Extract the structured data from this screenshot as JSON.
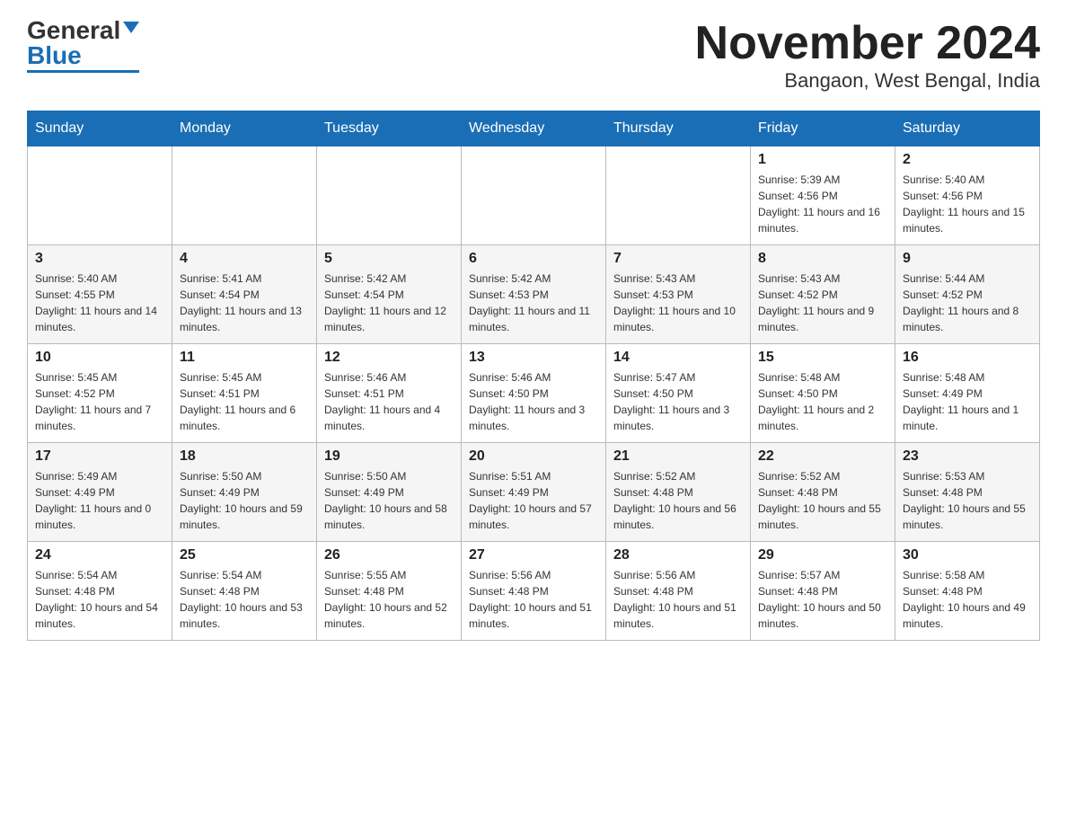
{
  "header": {
    "logo_general": "General",
    "logo_blue": "Blue",
    "month_title": "November 2024",
    "location": "Bangaon, West Bengal, India"
  },
  "days_of_week": [
    "Sunday",
    "Monday",
    "Tuesday",
    "Wednesday",
    "Thursday",
    "Friday",
    "Saturday"
  ],
  "weeks": [
    [
      {
        "day": "",
        "info": ""
      },
      {
        "day": "",
        "info": ""
      },
      {
        "day": "",
        "info": ""
      },
      {
        "day": "",
        "info": ""
      },
      {
        "day": "",
        "info": ""
      },
      {
        "day": "1",
        "info": "Sunrise: 5:39 AM\nSunset: 4:56 PM\nDaylight: 11 hours and 16 minutes."
      },
      {
        "day": "2",
        "info": "Sunrise: 5:40 AM\nSunset: 4:56 PM\nDaylight: 11 hours and 15 minutes."
      }
    ],
    [
      {
        "day": "3",
        "info": "Sunrise: 5:40 AM\nSunset: 4:55 PM\nDaylight: 11 hours and 14 minutes."
      },
      {
        "day": "4",
        "info": "Sunrise: 5:41 AM\nSunset: 4:54 PM\nDaylight: 11 hours and 13 minutes."
      },
      {
        "day": "5",
        "info": "Sunrise: 5:42 AM\nSunset: 4:54 PM\nDaylight: 11 hours and 12 minutes."
      },
      {
        "day": "6",
        "info": "Sunrise: 5:42 AM\nSunset: 4:53 PM\nDaylight: 11 hours and 11 minutes."
      },
      {
        "day": "7",
        "info": "Sunrise: 5:43 AM\nSunset: 4:53 PM\nDaylight: 11 hours and 10 minutes."
      },
      {
        "day": "8",
        "info": "Sunrise: 5:43 AM\nSunset: 4:52 PM\nDaylight: 11 hours and 9 minutes."
      },
      {
        "day": "9",
        "info": "Sunrise: 5:44 AM\nSunset: 4:52 PM\nDaylight: 11 hours and 8 minutes."
      }
    ],
    [
      {
        "day": "10",
        "info": "Sunrise: 5:45 AM\nSunset: 4:52 PM\nDaylight: 11 hours and 7 minutes."
      },
      {
        "day": "11",
        "info": "Sunrise: 5:45 AM\nSunset: 4:51 PM\nDaylight: 11 hours and 6 minutes."
      },
      {
        "day": "12",
        "info": "Sunrise: 5:46 AM\nSunset: 4:51 PM\nDaylight: 11 hours and 4 minutes."
      },
      {
        "day": "13",
        "info": "Sunrise: 5:46 AM\nSunset: 4:50 PM\nDaylight: 11 hours and 3 minutes."
      },
      {
        "day": "14",
        "info": "Sunrise: 5:47 AM\nSunset: 4:50 PM\nDaylight: 11 hours and 3 minutes."
      },
      {
        "day": "15",
        "info": "Sunrise: 5:48 AM\nSunset: 4:50 PM\nDaylight: 11 hours and 2 minutes."
      },
      {
        "day": "16",
        "info": "Sunrise: 5:48 AM\nSunset: 4:49 PM\nDaylight: 11 hours and 1 minute."
      }
    ],
    [
      {
        "day": "17",
        "info": "Sunrise: 5:49 AM\nSunset: 4:49 PM\nDaylight: 11 hours and 0 minutes."
      },
      {
        "day": "18",
        "info": "Sunrise: 5:50 AM\nSunset: 4:49 PM\nDaylight: 10 hours and 59 minutes."
      },
      {
        "day": "19",
        "info": "Sunrise: 5:50 AM\nSunset: 4:49 PM\nDaylight: 10 hours and 58 minutes."
      },
      {
        "day": "20",
        "info": "Sunrise: 5:51 AM\nSunset: 4:49 PM\nDaylight: 10 hours and 57 minutes."
      },
      {
        "day": "21",
        "info": "Sunrise: 5:52 AM\nSunset: 4:48 PM\nDaylight: 10 hours and 56 minutes."
      },
      {
        "day": "22",
        "info": "Sunrise: 5:52 AM\nSunset: 4:48 PM\nDaylight: 10 hours and 55 minutes."
      },
      {
        "day": "23",
        "info": "Sunrise: 5:53 AM\nSunset: 4:48 PM\nDaylight: 10 hours and 55 minutes."
      }
    ],
    [
      {
        "day": "24",
        "info": "Sunrise: 5:54 AM\nSunset: 4:48 PM\nDaylight: 10 hours and 54 minutes."
      },
      {
        "day": "25",
        "info": "Sunrise: 5:54 AM\nSunset: 4:48 PM\nDaylight: 10 hours and 53 minutes."
      },
      {
        "day": "26",
        "info": "Sunrise: 5:55 AM\nSunset: 4:48 PM\nDaylight: 10 hours and 52 minutes."
      },
      {
        "day": "27",
        "info": "Sunrise: 5:56 AM\nSunset: 4:48 PM\nDaylight: 10 hours and 51 minutes."
      },
      {
        "day": "28",
        "info": "Sunrise: 5:56 AM\nSunset: 4:48 PM\nDaylight: 10 hours and 51 minutes."
      },
      {
        "day": "29",
        "info": "Sunrise: 5:57 AM\nSunset: 4:48 PM\nDaylight: 10 hours and 50 minutes."
      },
      {
        "day": "30",
        "info": "Sunrise: 5:58 AM\nSunset: 4:48 PM\nDaylight: 10 hours and 49 minutes."
      }
    ]
  ]
}
